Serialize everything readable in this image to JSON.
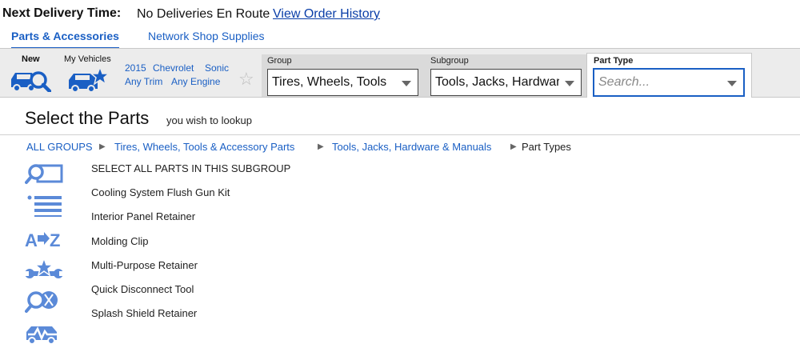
{
  "delivery": {
    "label": "Next Delivery Time:",
    "status": "No Deliveries En Route",
    "history_link": "View Order History"
  },
  "tabs": [
    {
      "label": "Parts & Accessories",
      "active": true
    },
    {
      "label": "Network Shop Supplies",
      "active": false
    }
  ],
  "vehicle_bar": {
    "new_label": "New",
    "my_vehicles_label": "My Vehicles",
    "year": "2015",
    "make": "Chevrolet",
    "model": "Sonic",
    "trim": "Any Trim",
    "engine": "Any Engine"
  },
  "selectors": {
    "group": {
      "label": "Group",
      "value": "Tires, Wheels, Tools"
    },
    "subgroup": {
      "label": "Subgroup",
      "value": "Tools, Jacks, Hardware & Manuals"
    },
    "part_type": {
      "label": "Part Type",
      "placeholder": "Search..."
    }
  },
  "heading": {
    "title": "Select the Parts",
    "subtitle": "you wish to lookup"
  },
  "breadcrumb": [
    "ALL GROUPS",
    "Tires, Wheels, Tools & Accessory Parts",
    "Tools, Jacks, Hardware & Manuals",
    "Part Types"
  ],
  "parts": [
    "SELECT ALL PARTS IN THIS SUBGROUP",
    "Cooling System Flush Gun Kit",
    "Interior Panel Retainer",
    "Molding Clip",
    "Multi-Purpose Retainer",
    "Quick Disconnect Tool",
    "Splash Shield Retainer"
  ],
  "tool_icons": [
    "search-box-icon",
    "list-icon",
    "a-to-z-icon",
    "wrench-star-icon",
    "search-tire-icon",
    "car-diagnostic-icon"
  ],
  "colors": {
    "accent": "#1a5fc4",
    "icon": "#5b8ad8",
    "bar_bg": "#ececec"
  }
}
